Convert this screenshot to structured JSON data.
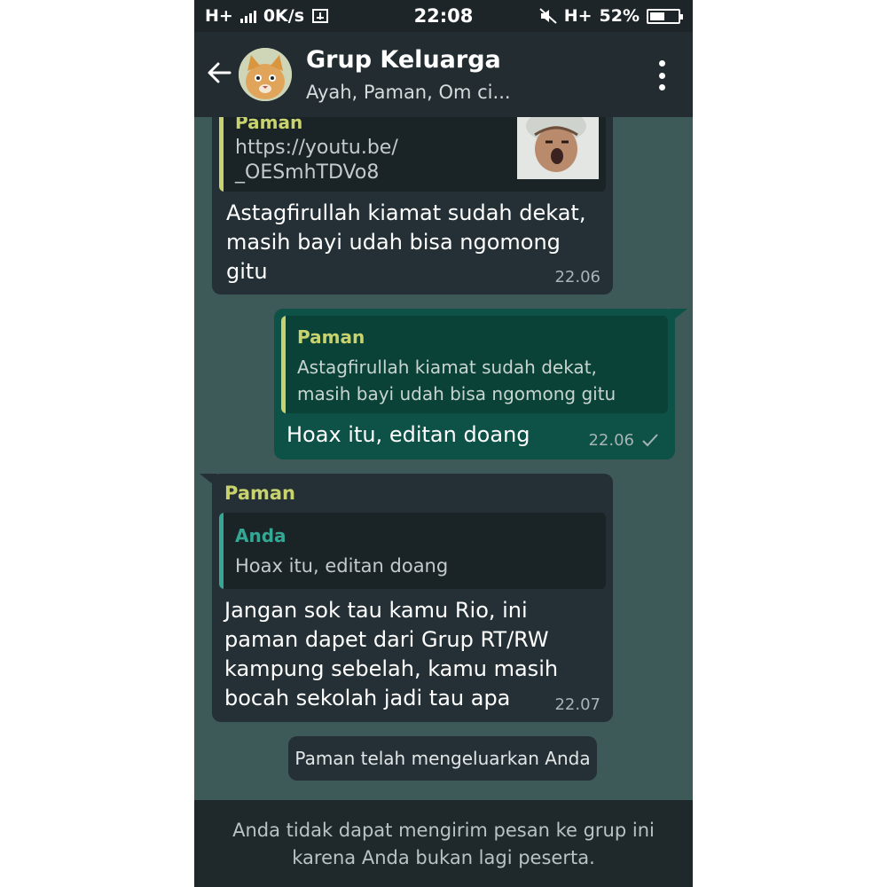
{
  "status_bar": {
    "network": "H+",
    "data_speed": "0K/s",
    "time": "22:08",
    "network2": "H+",
    "battery": "52%",
    "battery_level": 0.52
  },
  "header": {
    "title": "Grup Keluarga",
    "subtitle": "Ayah, Paman, Om ci..."
  },
  "messages": [
    {
      "quote_author": "Paman",
      "quote_link_line1": "https://youtu.be/",
      "quote_link_line2": "_OESmhTDVo8",
      "lines": [
        "Astagfirullah kiamat sudah dekat,",
        "masih bayi udah bisa ngomong",
        "gitu"
      ],
      "time": "22.06"
    },
    {
      "quote_author": "Paman",
      "quote_line1": "Astagfirullah kiamat sudah dekat,",
      "quote_line2": "masih bayi udah bisa ngomong gitu",
      "text": "Hoax itu, editan doang",
      "time": "22.06"
    },
    {
      "sender": "Paman",
      "quote_author": "Anda",
      "quote_text": "Hoax itu, editan doang",
      "lines": [
        "Jangan sok tau kamu Rio, ini",
        "paman dapet dari Grup RT/RW",
        "kampung sebelah, kamu masih",
        "bocah sekolah jadi tau apa"
      ],
      "time": "22.07"
    }
  ],
  "system_message": "Paman telah mengeluarkan Anda",
  "footer": {
    "line1": "Anda tidak dapat mengirim pesan ke grup ini",
    "line2": "karena Anda bukan lagi peserta."
  },
  "colors": {
    "chat_background": "#3e5a58",
    "incoming_bubble": "#243035",
    "outgoing_bubble": "#0d5147",
    "sender_name": "#c9d36e",
    "quote_self": "#34a895"
  }
}
